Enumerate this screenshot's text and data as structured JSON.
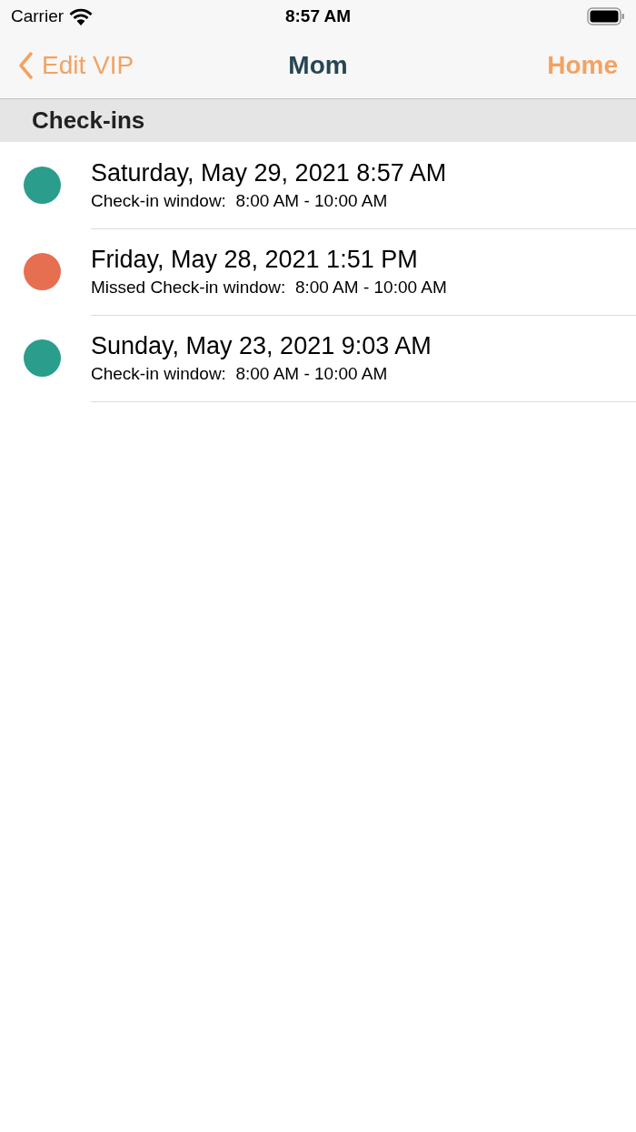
{
  "status_bar": {
    "carrier": "Carrier",
    "time": "8:57 AM"
  },
  "nav_bar": {
    "back": "Edit VIP",
    "title": "Mom",
    "action": "Home"
  },
  "section": {
    "title": "Check-ins"
  },
  "checkins": [
    {
      "datetime": "Saturday, May 29, 2021 8:57 AM",
      "window": "Check-in window:  8:00 AM - 10:00 AM",
      "color": "#2a9d8c"
    },
    {
      "datetime": "Friday, May 28, 2021 1:51 PM",
      "window": "Missed Check-in window:  8:00 AM - 10:00 AM",
      "color": "#e76f51"
    },
    {
      "datetime": "Sunday, May 23, 2021 9:03 AM",
      "window": "Check-in window:  8:00 AM - 10:00 AM",
      "color": "#2a9d8c"
    }
  ]
}
